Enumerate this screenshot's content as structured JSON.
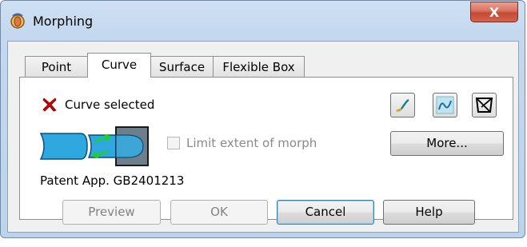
{
  "window": {
    "title": "Morphing",
    "app_icon": "morph-app-icon",
    "close_label": "X"
  },
  "tabs": [
    {
      "label": "Point",
      "active": false
    },
    {
      "label": "Curve",
      "active": true
    },
    {
      "label": "Surface",
      "active": false
    },
    {
      "label": "Flexible Box",
      "active": false
    }
  ],
  "status": {
    "icon": "red-x-icon",
    "text": "Curve selected"
  },
  "tool_icons": [
    "curve-select-icon",
    "curve-morph-icon",
    "curve-box-icon"
  ],
  "options": {
    "limit_extent_label": "Limit extent of morph",
    "limit_extent_checked": false,
    "limit_extent_enabled": false,
    "more_label": "More..."
  },
  "patent_text": "Patent App. GB2401213",
  "buttons": {
    "preview": "Preview",
    "ok": "OK",
    "cancel": "Cancel",
    "help": "Help"
  },
  "colors": {
    "accent": "#3c7fb1",
    "status_error": "#d10000",
    "title_bar": "#c4d8ef",
    "close_button": "#c44a34"
  }
}
